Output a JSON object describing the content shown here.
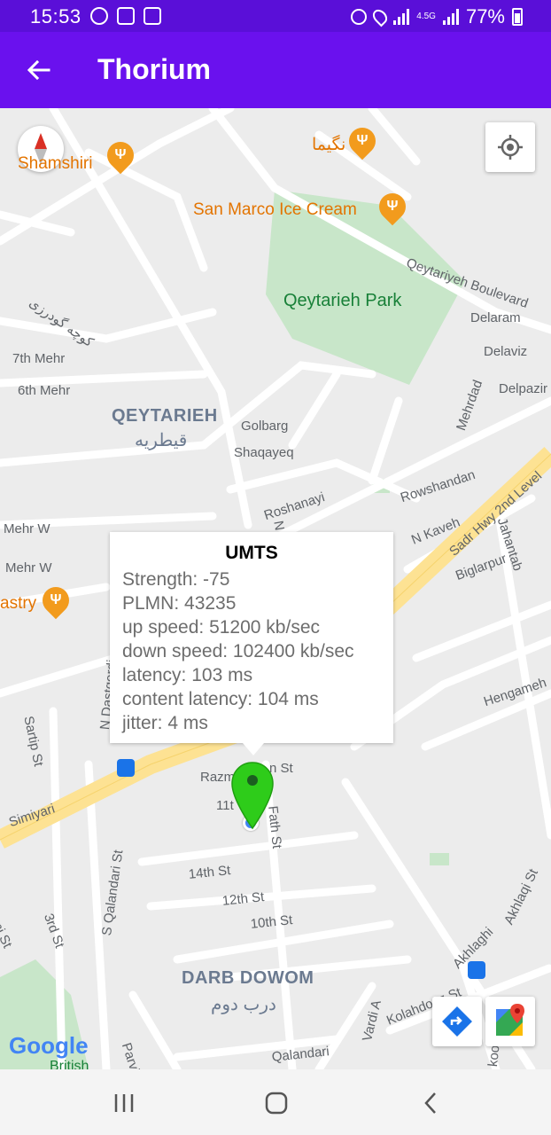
{
  "status_bar": {
    "time": "15:53",
    "network_type": "4.5G",
    "battery": "77%"
  },
  "app_bar": {
    "title": "Thorium",
    "back_icon": "arrow-left-icon"
  },
  "map": {
    "pois": [
      {
        "name": "Shamshiri"
      },
      {
        "name": "نگیما"
      },
      {
        "name": "San Marco Ice Cream"
      },
      {
        "name": "astry"
      }
    ],
    "parks": [
      {
        "name": "Qeytarieh Park"
      }
    ],
    "areas": [
      {
        "name": "QEYTARIEH",
        "name_fa": "قیطریه"
      },
      {
        "name": "DARB DOWOM",
        "name_fa": "درب دوم"
      }
    ],
    "streets": {
      "s1": "Qeytariyeh Boulevard",
      "s2": "Delaram",
      "s3": "Delaviz",
      "s4": "Delpazir",
      "s5": "7th Mehr",
      "s6": "6th Mehr",
      "s7": "Golbarg",
      "s8": "Shaqayeq",
      "s9": "Mehrdad",
      "s10": "Roshanayi",
      "s11": "Rowshandan",
      "s12": "N Kaveh",
      "s13": "Sadr Hwy 2nd Level",
      "s14": "Jahantab",
      "s15": "Biglarpur",
      "s16": "Mehr W",
      "s17": "Mehr W",
      "s18": "Hengameh",
      "s19": "Sartip St",
      "s20": "N Dastgerdi",
      "s21": "Razm",
      "s22": "n St",
      "s23": "11t",
      "s24": "Fath St",
      "s25": "Simiyari",
      "s26": "14th St",
      "s27": "12th St",
      "s28": "10th St",
      "s29": "S Qalandari St",
      "s30": "3rd St",
      "s31": "Akhlaqi St",
      "s32": "Akhlaghi",
      "s33": "Kolahdouz St",
      "s34": "Qalandari",
      "s35": "Vardi A",
      "s36": "Parvi",
      "s37": "kooh St",
      "s38": "ani St",
      "s39": "N Pa",
      "s40": "کوچه گودرزی"
    },
    "google_logo": "Google",
    "google_sub": "British",
    "controls": {
      "compass_icon": "compass-icon",
      "my_location_icon": "my-location-icon",
      "directions_icon": "directions-icon",
      "maps_icon": "google-maps-icon"
    }
  },
  "info_window": {
    "title": "UMTS",
    "lines": [
      "Strength: -75",
      "PLMN: 43235",
      "up speed: 51200 kb/sec",
      "down speed: 102400 kb/sec",
      "latency: 103 ms",
      "content latency: 104 ms",
      "jitter: 4 ms"
    ]
  },
  "nav_bar": {
    "recents_icon": "recents-icon",
    "home_icon": "home-icon",
    "back_icon": "back-chevron-icon"
  },
  "colors": {
    "status_bar": "#5a0fd8",
    "app_bar": "#6a11ee",
    "marker": "#2ecc1a",
    "highway": "#fde293",
    "park": "#c8e6c9"
  }
}
